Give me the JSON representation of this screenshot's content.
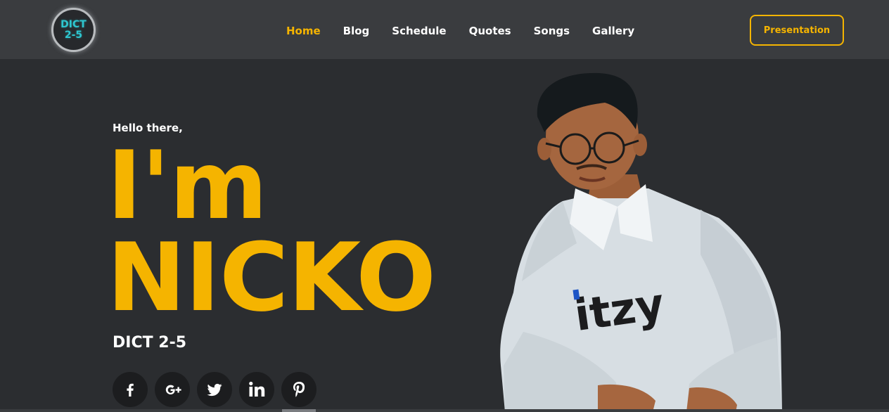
{
  "logo": {
    "line1": "DICT",
    "line2": "2-5"
  },
  "nav": {
    "items": [
      {
        "label": "Home",
        "active": true
      },
      {
        "label": "Blog",
        "active": false
      },
      {
        "label": "Schedule",
        "active": false
      },
      {
        "label": "Quotes",
        "active": false
      },
      {
        "label": "Songs",
        "active": false
      },
      {
        "label": "Gallery",
        "active": false
      }
    ],
    "cta_label": "Presentation"
  },
  "hero": {
    "greeting": "Hello there,",
    "line1": "I'm",
    "line2": "NICKO",
    "subtitle": "DICT 2-5",
    "shirt_text": "itzy"
  },
  "socials": [
    {
      "icon": "facebook-icon"
    },
    {
      "icon": "google-plus-icon"
    },
    {
      "icon": "twitter-icon"
    },
    {
      "icon": "linkedin-icon"
    },
    {
      "icon": "pinterest-icon"
    }
  ],
  "colors": {
    "accent": "#f5b400",
    "navbar": "#3a3c3f",
    "background": "#2b2d30",
    "logo_text": "#2ec6cf"
  }
}
